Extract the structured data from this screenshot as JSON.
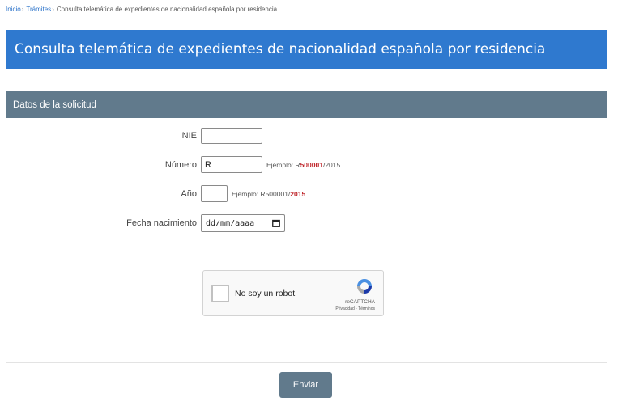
{
  "breadcrumb": {
    "items": [
      "Inicio",
      "Trámites"
    ],
    "separator": "›",
    "current": "Consulta telemática de expedientes de nacionalidad española por residencia"
  },
  "page": {
    "title": "Consulta telemática de expedientes de nacionalidad española por residencia"
  },
  "section": {
    "title": "Datos de la solicitud"
  },
  "form": {
    "nie": {
      "label": "NIE",
      "value": ""
    },
    "numero": {
      "label": "Número",
      "value": "R",
      "hint_prefix": "Ejemplo: R",
      "hint_highlight": "500001",
      "hint_suffix": "/2015"
    },
    "anio": {
      "label": "Año",
      "value": "",
      "hint_prefix": "Ejemplo: R500001/",
      "hint_highlight": "2015"
    },
    "fecha": {
      "label": "Fecha nacimiento",
      "placeholder": "dd/mm/aaaa"
    }
  },
  "captcha": {
    "label": "No soy un robot",
    "brand": "reCAPTCHA",
    "privacy": "Privacidad",
    "terms": "Términos",
    "links_separator": "-"
  },
  "submit": {
    "label": "Enviar"
  },
  "colors": {
    "title_bar": "#2f79cf",
    "section_header": "#617a8c",
    "link": "#2a72c9",
    "hint_highlight": "#c0282d",
    "button": "#617a8c"
  }
}
